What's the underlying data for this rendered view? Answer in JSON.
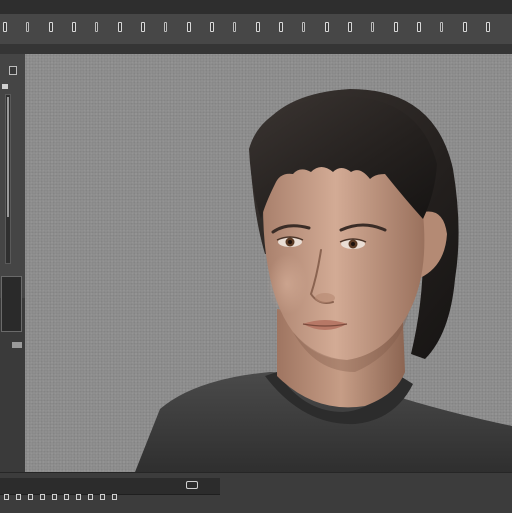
{
  "toolbar": {
    "icons": [
      "toolbar-slot-icon",
      "toolbar-slot-icon",
      "toolbar-slot-icon",
      "toolbar-slot-icon",
      "toolbar-slot-icon",
      "toolbar-slot-icon",
      "toolbar-slot-icon",
      "toolbar-slot-icon",
      "toolbar-slot-icon",
      "toolbar-slot-icon",
      "toolbar-slot-icon",
      "toolbar-slot-icon",
      "toolbar-slot-icon",
      "toolbar-slot-icon",
      "toolbar-slot-icon",
      "toolbar-slot-icon",
      "toolbar-slot-icon",
      "toolbar-slot-icon",
      "toolbar-slot-icon",
      "toolbar-slot-icon",
      "toolbar-slot-icon",
      "toolbar-slot-icon"
    ],
    "colors": {
      "bar": "#474747",
      "icon": "#d8d8d8"
    }
  },
  "left_panel": {
    "swatch_label": "",
    "colors": {
      "panel": "#454545",
      "swatch": "#2a2a2a"
    }
  },
  "viewport": {
    "background_color": "#8f8f8f",
    "subject": {
      "hair_color": "#2b2623",
      "skin_color": "#c39a84",
      "shirt_color": "#3b3b3b",
      "eye_color": "#5a3a24"
    }
  },
  "timeline": {
    "readout": ""
  }
}
